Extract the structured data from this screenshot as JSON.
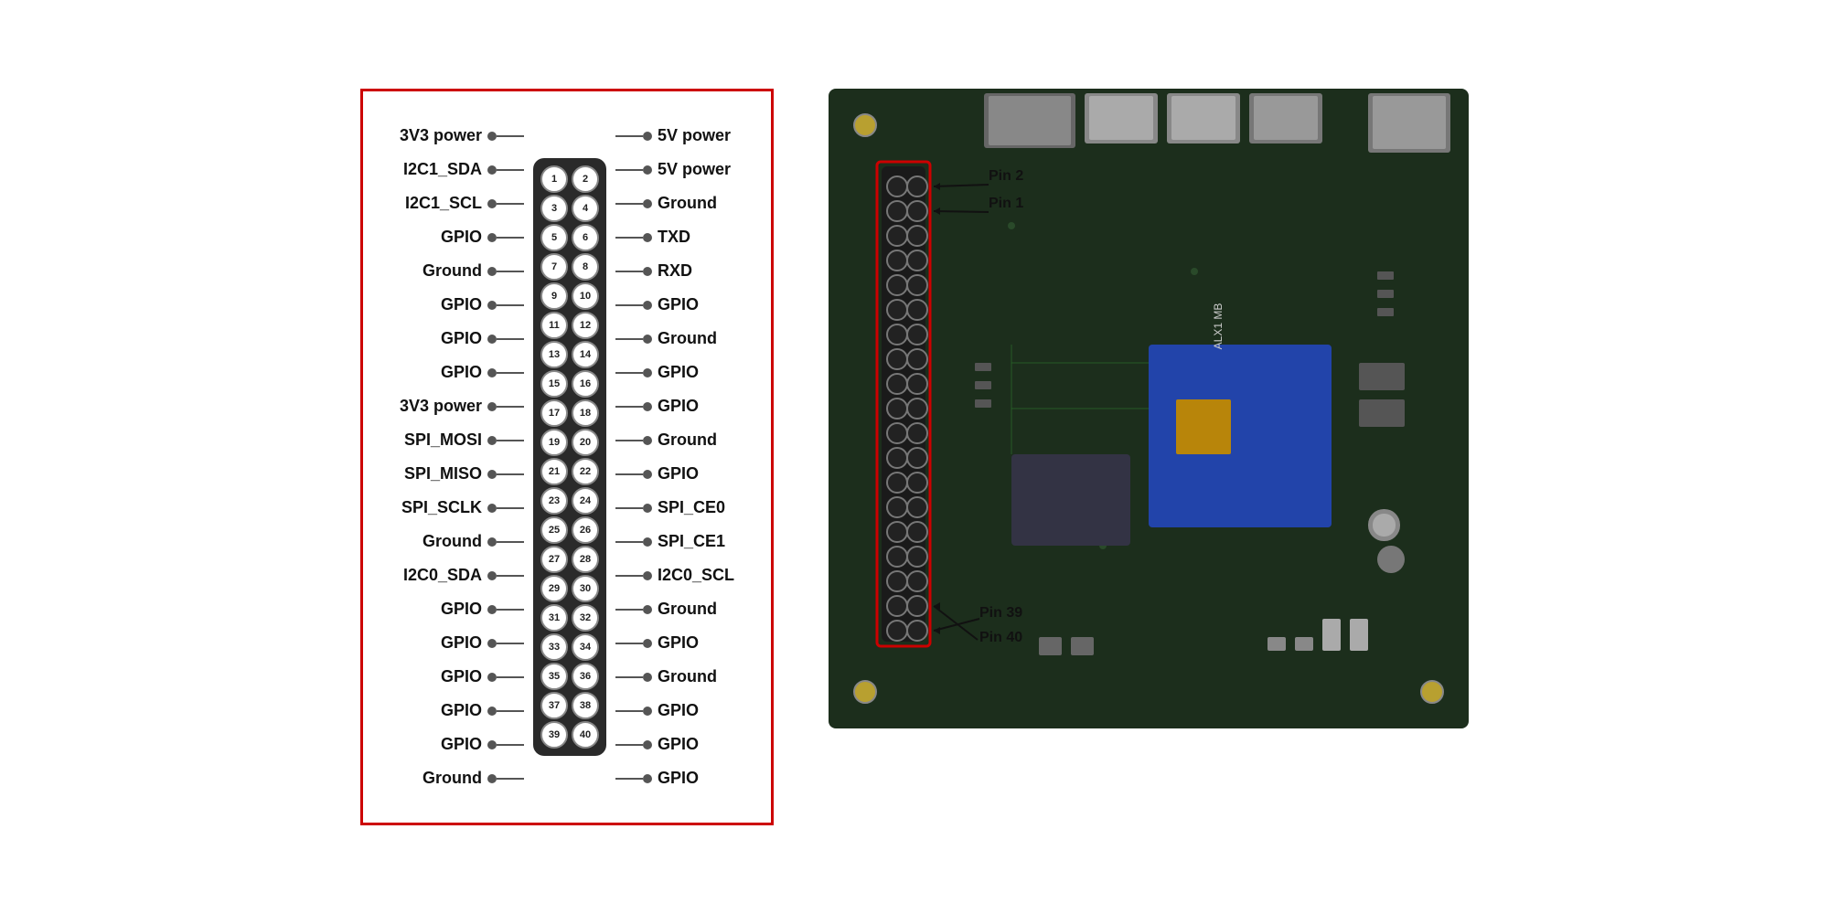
{
  "diagram": {
    "border_color": "#cc0000",
    "pins": [
      {
        "left": "3V3 power",
        "pair": [
          1,
          2
        ],
        "right": "5V power"
      },
      {
        "left": "I2C1_SDA",
        "pair": [
          3,
          4
        ],
        "right": "5V power"
      },
      {
        "left": "I2C1_SCL",
        "pair": [
          5,
          6
        ],
        "right": "Ground"
      },
      {
        "left": "GPIO",
        "pair": [
          7,
          8
        ],
        "right": "TXD"
      },
      {
        "left": "Ground",
        "pair": [
          9,
          10
        ],
        "right": "RXD"
      },
      {
        "left": "GPIO",
        "pair": [
          11,
          12
        ],
        "right": "GPIO"
      },
      {
        "left": "GPIO",
        "pair": [
          13,
          14
        ],
        "right": "Ground"
      },
      {
        "left": "GPIO",
        "pair": [
          15,
          16
        ],
        "right": "GPIO"
      },
      {
        "left": "3V3 power",
        "pair": [
          17,
          18
        ],
        "right": "GPIO"
      },
      {
        "left": "SPI_MOSI",
        "pair": [
          19,
          20
        ],
        "right": "Ground"
      },
      {
        "left": "SPI_MISO",
        "pair": [
          21,
          22
        ],
        "right": "GPIO"
      },
      {
        "left": "SPI_SCLK",
        "pair": [
          23,
          24
        ],
        "right": "SPI_CE0"
      },
      {
        "left": "Ground",
        "pair": [
          25,
          26
        ],
        "right": "SPI_CE1"
      },
      {
        "left": "I2C0_SDA",
        "pair": [
          27,
          28
        ],
        "right": "I2C0_SCL"
      },
      {
        "left": "GPIO",
        "pair": [
          29,
          30
        ],
        "right": "Ground"
      },
      {
        "left": "GPIO",
        "pair": [
          31,
          32
        ],
        "right": "GPIO"
      },
      {
        "left": "GPIO",
        "pair": [
          33,
          34
        ],
        "right": "Ground"
      },
      {
        "left": "GPIO",
        "pair": [
          35,
          36
        ],
        "right": "GPIO"
      },
      {
        "left": "GPIO",
        "pair": [
          37,
          38
        ],
        "right": "GPIO"
      },
      {
        "left": "Ground",
        "pair": [
          39,
          40
        ],
        "right": "GPIO"
      }
    ]
  },
  "board": {
    "annotations": [
      {
        "label": "Pin 2",
        "position": "top-left"
      },
      {
        "label": "Pin 1",
        "position": "mid-left"
      },
      {
        "label": "Pin 39",
        "position": "bottom-left"
      },
      {
        "label": "Pin 40",
        "position": "bottom-left-2"
      }
    ]
  }
}
